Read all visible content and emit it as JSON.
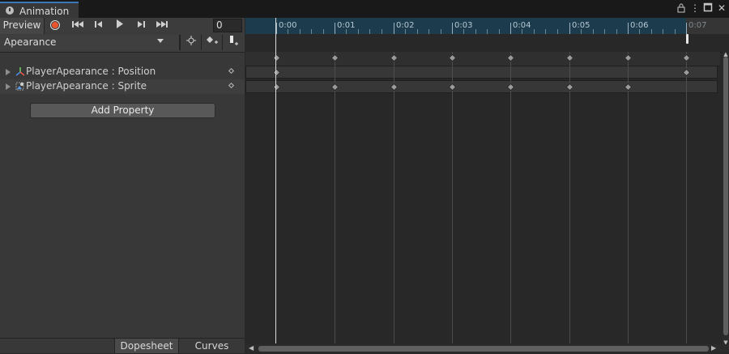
{
  "window": {
    "tab_title": "Animation",
    "tab_icon": "clock-icon",
    "lock_icon": "lock-icon",
    "menu_icon": "kebab-menu-icon",
    "maximize_icon": "maximize-icon",
    "close_icon": "close-icon"
  },
  "toolbar": {
    "preview_label": "Preview",
    "record_icon": "record-icon",
    "first_key_icon": "first-keyframe-icon",
    "prev_key_icon": "previous-keyframe-icon",
    "play_icon": "play-icon",
    "next_key_icon": "next-keyframe-icon",
    "last_key_icon": "last-keyframe-icon",
    "frame_value": "0",
    "record_color": "#e8542d"
  },
  "clip": {
    "selected_clip": "Apearance",
    "filter_icon": "filter-keyframes-icon",
    "add_keyframe_icon": "add-keyframe-icon",
    "add_event_icon": "add-event-icon"
  },
  "properties": [
    {
      "label": "PlayerApearance : Position",
      "icon": "transform-icon"
    },
    {
      "label": "PlayerApearance : Sprite",
      "icon": "sprite-icon"
    }
  ],
  "add_property_label": "Add Property",
  "bottom_tabs": {
    "dopesheet": "Dopesheet",
    "curves": "Curves",
    "active": "Dopesheet"
  },
  "timeline": {
    "time_labels": [
      "0:00",
      "0:01",
      "0:02",
      "0:03",
      "0:04",
      "0:05",
      "0:06",
      "0:07"
    ],
    "playhead_time": "0:00",
    "clip_end_time": "0:07",
    "summary_keys": [
      "0:00",
      "0:01",
      "0:02",
      "0:03",
      "0:04",
      "0:05",
      "0:06",
      "0:07"
    ],
    "position_keys": [
      "0:00",
      "0:07"
    ],
    "sprite_keys": [
      "0:00",
      "0:01",
      "0:02",
      "0:03",
      "0:04",
      "0:05",
      "0:06"
    ],
    "ruler_color": "#1c3c4e"
  }
}
